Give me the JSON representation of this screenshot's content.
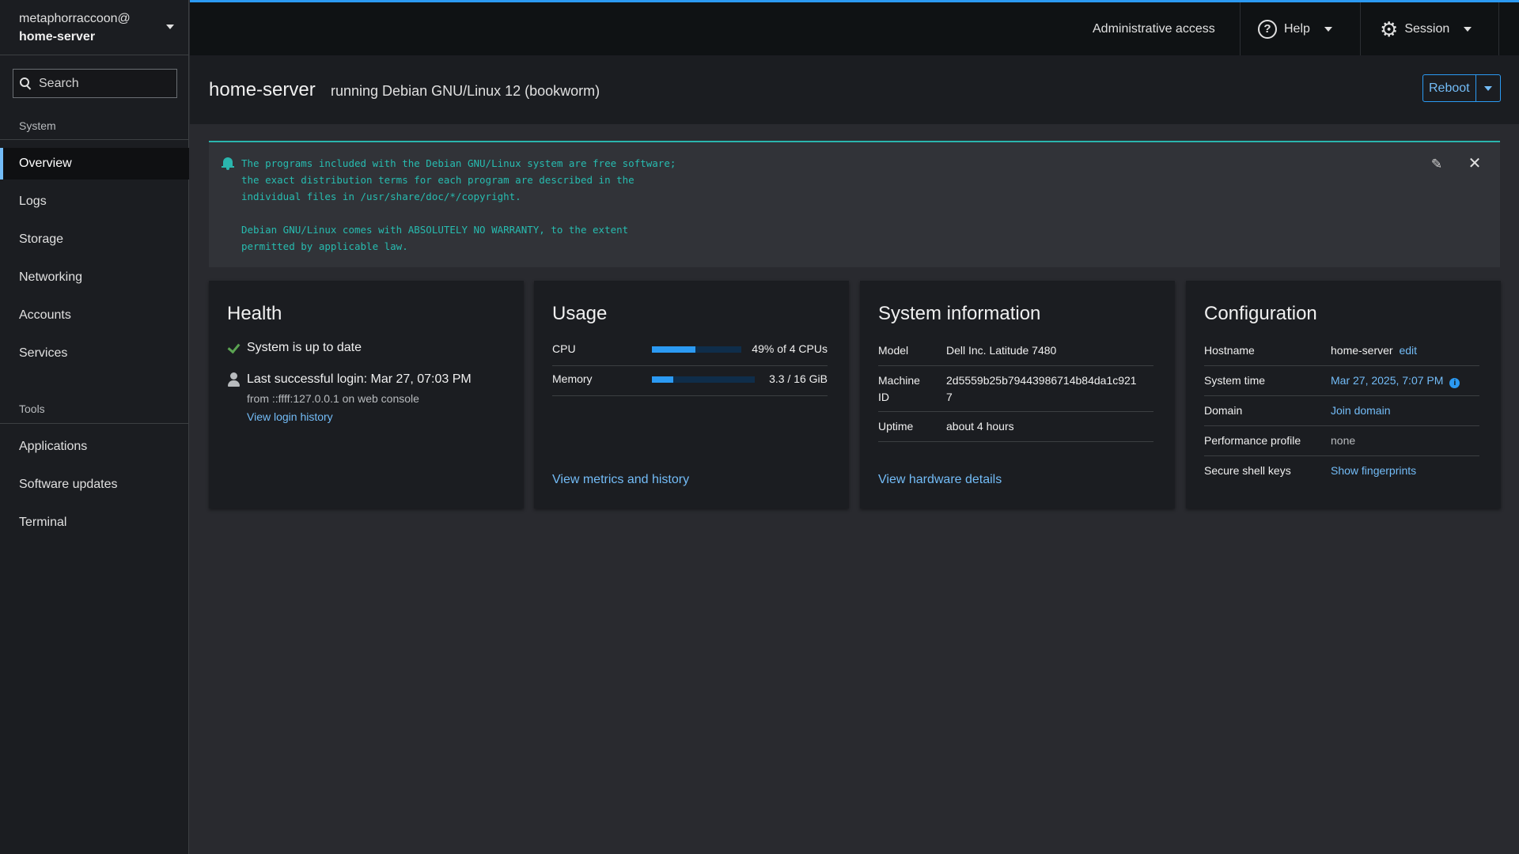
{
  "host": {
    "user": "metaphorraccoon@",
    "name": "home-server"
  },
  "search": {
    "placeholder": "Search"
  },
  "nav": {
    "system_title": "System",
    "system_items": [
      "Overview",
      "Logs",
      "Storage",
      "Networking",
      "Accounts",
      "Services"
    ],
    "tools_title": "Tools",
    "tools_items": [
      "Applications",
      "Software updates",
      "Terminal"
    ],
    "active": "Overview"
  },
  "topbar": {
    "admin": "Administrative access",
    "help": "Help",
    "session": "Session"
  },
  "header": {
    "title": "home-server",
    "subtitle": "running Debian GNU/Linux 12 (bookworm)",
    "reboot": "Reboot"
  },
  "motd": {
    "text": "The programs included with the Debian GNU/Linux system are free software;\nthe exact distribution terms for each program are described in the\nindividual files in /usr/share/doc/*/copyright.\n\nDebian GNU/Linux comes with ABSOLUTELY NO WARRANTY, to the extent\npermitted by applicable law."
  },
  "health": {
    "title": "Health",
    "status": "System is up to date",
    "last_login": "Last successful login: Mar 27, 07:03 PM",
    "login_from": "from ::ffff:127.0.0.1 on web console",
    "history_link": "View login history"
  },
  "usage": {
    "title": "Usage",
    "cpu": {
      "label": "CPU",
      "value": "49% of 4 CPUs",
      "fraction": 0.49
    },
    "memory": {
      "label": "Memory",
      "value": "3.3 / 16 GiB",
      "fraction": 0.206
    },
    "link": "View metrics and history"
  },
  "sysinfo": {
    "title": "System information",
    "model_label": "Model",
    "model": "Dell Inc. Latitude 7480",
    "machine_id_label_1": "Machine",
    "machine_id_label_2": "ID",
    "machine_id_1": "2d5559b25b79443986714b84da1c921",
    "machine_id_2": "7",
    "uptime_label": "Uptime",
    "uptime": "about 4 hours",
    "link": "View hardware details"
  },
  "config": {
    "title": "Configuration",
    "hostname_label": "Hostname",
    "hostname": "home-server",
    "hostname_edit": "edit",
    "time_label": "System time",
    "time": "Mar 27, 2025, 7:07 PM",
    "domain_label": "Domain",
    "domain": "Join domain",
    "perf_label": "Performance profile",
    "perf": "none",
    "ssh_label": "Secure shell keys",
    "ssh": "Show fingerprints"
  },
  "colors": {
    "accent": "#2b9af3",
    "link": "#73bcf7",
    "motd": "#27bcb0",
    "success": "#5ba352"
  }
}
